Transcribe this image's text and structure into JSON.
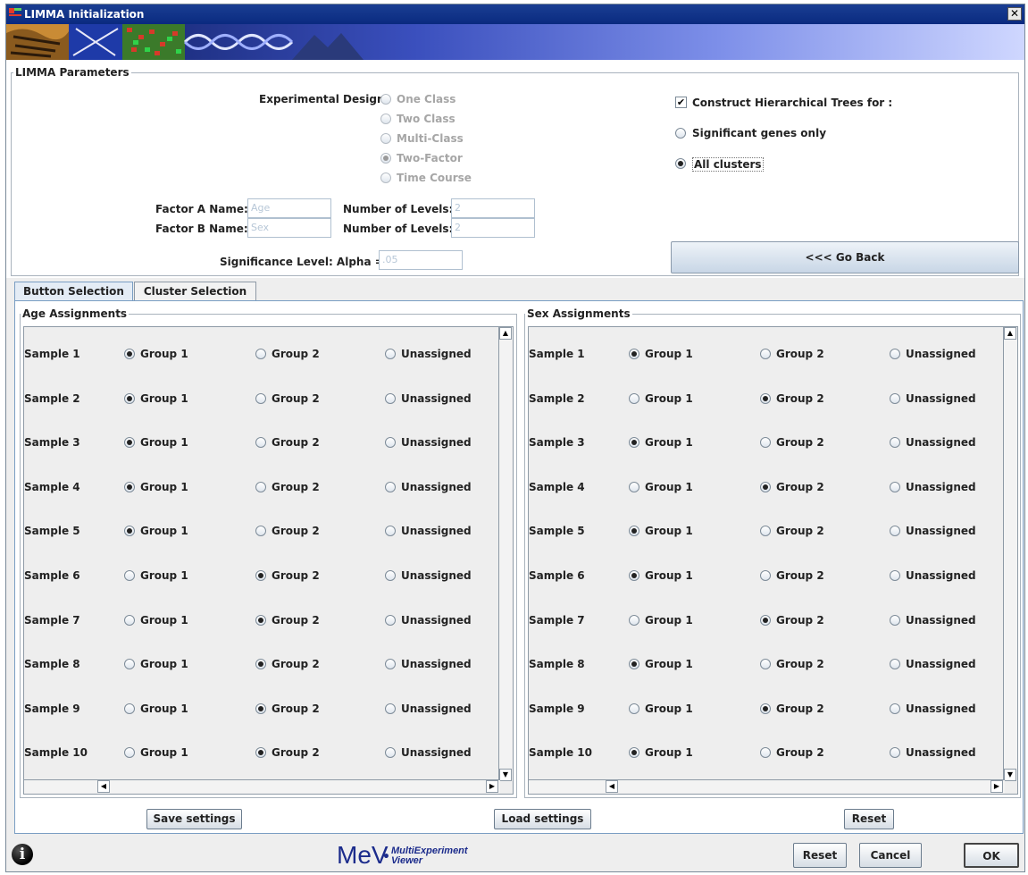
{
  "window": {
    "title": "LIMMA Initialization",
    "close_glyph": "✕"
  },
  "params": {
    "legend": "LIMMA Parameters",
    "design_label": "Experimental Design:",
    "design_options": [
      "One Class",
      "Two Class",
      "Multi-Class",
      "Two-Factor",
      "Time Course"
    ],
    "design_selected": "Two-Factor",
    "construct_trees_label": "Construct Hierarchical Trees for :",
    "construct_trees_checked": true,
    "significant_genes_label": "Significant genes only",
    "all_clusters_label": "All clusters",
    "tree_option_selected": "All clusters",
    "factor_a_label": "Factor A Name:",
    "factor_a_value": "Age",
    "factor_b_label": "Factor B Name:",
    "factor_b_value": "Sex",
    "levels_label": "Number of Levels:",
    "levels_a_value": "2",
    "levels_b_value": "2",
    "alpha_label": "Significance Level: Alpha =",
    "alpha_value": ".05",
    "go_back_label": "<<< Go Back"
  },
  "tabs": [
    {
      "label": "Button Selection",
      "active": true
    },
    {
      "label": "Cluster Selection",
      "active": false
    }
  ],
  "age_panel": {
    "legend": "Age Assignments",
    "options": [
      "Group 1",
      "Group 2",
      "Unassigned"
    ],
    "rows": [
      {
        "label": "Sample 1",
        "selected": 0
      },
      {
        "label": "Sample 2",
        "selected": 0
      },
      {
        "label": "Sample 3",
        "selected": 0
      },
      {
        "label": "Sample 4",
        "selected": 0
      },
      {
        "label": "Sample 5",
        "selected": 0
      },
      {
        "label": "Sample 6",
        "selected": 1
      },
      {
        "label": "Sample 7",
        "selected": 1
      },
      {
        "label": "Sample 8",
        "selected": 1
      },
      {
        "label": "Sample 9",
        "selected": 1
      },
      {
        "label": "Sample 10",
        "selected": 1
      }
    ]
  },
  "sex_panel": {
    "legend": "Sex Assignments",
    "options": [
      "Group 1",
      "Group 2",
      "Unassigned"
    ],
    "rows": [
      {
        "label": "Sample 1",
        "selected": 0
      },
      {
        "label": "Sample 2",
        "selected": 1
      },
      {
        "label": "Sample 3",
        "selected": 0
      },
      {
        "label": "Sample 4",
        "selected": 1
      },
      {
        "label": "Sample 5",
        "selected": 0
      },
      {
        "label": "Sample 6",
        "selected": 0
      },
      {
        "label": "Sample 7",
        "selected": 1
      },
      {
        "label": "Sample 8",
        "selected": 0
      },
      {
        "label": "Sample 9",
        "selected": 1
      },
      {
        "label": "Sample 10",
        "selected": 0
      }
    ]
  },
  "settings_buttons": {
    "save": "Save settings",
    "load": "Load settings",
    "reset": "Reset"
  },
  "footer": {
    "logo_main": "MeV",
    "logo_sub_1": "MultiExperiment",
    "logo_sub_2": "Viewer",
    "reset": "Reset",
    "cancel": "Cancel",
    "ok": "OK",
    "info_glyph": "i"
  },
  "colors": {
    "titlebar": "#0a2a80",
    "accent": "#1c2c8c",
    "goback": "#c8d6e6"
  }
}
